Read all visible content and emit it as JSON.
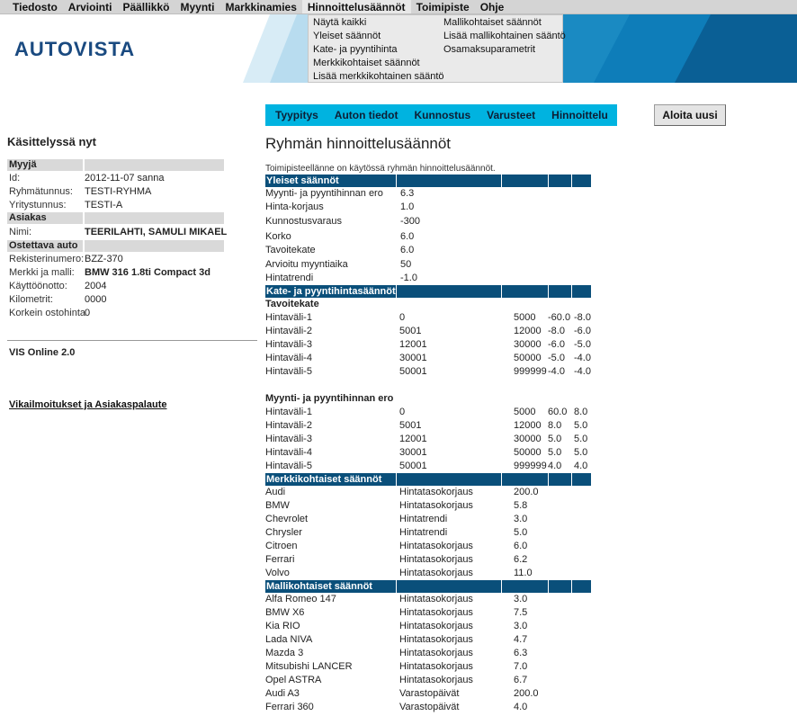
{
  "menu": [
    "Tiedosto",
    "Arviointi",
    "Päällikkö",
    "Myynti",
    "Markkinamies",
    "Hinnoittelusäännöt",
    "Toimipiste",
    "Ohje"
  ],
  "dropdown": {
    "col1": [
      "Näytä kaikki",
      "Yleiset säännöt",
      "Kate- ja pyyntihinta",
      "Merkkikohtaiset säännöt",
      "Lisää merkkikohtainen sääntö"
    ],
    "col2": [
      "Mallikohtaiset säännöt",
      "Lisää mallikohtainen sääntö",
      "Osamaksuparametrit"
    ]
  },
  "logo": "AUTOVISTA",
  "tabs": [
    "Tyypitys",
    "Auton tiedot",
    "Kunnostus",
    "Varusteet",
    "Hinnoittelu"
  ],
  "restart_label": "Aloita uusi",
  "left": {
    "title": "Käsittelyssä nyt",
    "sections": [
      {
        "heading": "Myyjä",
        "rows": [
          {
            "k": "Id:",
            "v": "2012-11-07  sanna",
            "bold": false
          },
          {
            "k": "Ryhmätunnus:",
            "v": "TESTI-RYHMA",
            "bold": false
          },
          {
            "k": "Yritystunnus:",
            "v": "TESTI-A",
            "bold": false
          }
        ]
      },
      {
        "heading": "Asiakas",
        "rows": [
          {
            "k": "Nimi:",
            "v": "TEERILAHTI, SAMULI MIKAEL",
            "bold": true
          }
        ]
      },
      {
        "heading": "Ostettava auto",
        "rows": [
          {
            "k": "Rekisterinumero:",
            "v": "BZZ-370",
            "bold": false
          },
          {
            "k": "Merkki ja malli:",
            "v": "BMW 316 1.8ti Compact 3d",
            "bold": true
          },
          {
            "k": "Käyttöönotto:",
            "v": "2004",
            "bold": false
          },
          {
            "k": "Kilometrit:",
            "v": "0000",
            "bold": false
          },
          {
            "k": "Korkein ostohinta",
            "v": "0",
            "bold": false
          }
        ]
      }
    ],
    "vis": "VIS Online 2.0",
    "feedback": "Vikailmoitukset ja Asiakaspalaute"
  },
  "main": {
    "title": "Ryhmän hinnoittelusäännöt",
    "intro": "Toimipisteellänne on käytössä ryhmän hinnoittelusäännöt.",
    "general": {
      "heading": "Yleiset säännöt",
      "rows": [
        {
          "label": "Myynti- ja pyyntihinnan ero",
          "value": "6.3"
        },
        {
          "label": "Hinta-korjaus",
          "value": "1.0"
        },
        {
          "label": "Kunnostusvaraus",
          "value": "-300"
        },
        {
          "label": "Korko",
          "value": "6.0"
        },
        {
          "label": "Tavoitekate",
          "value": "6.0"
        },
        {
          "label": "Arvioitu myyntiaika",
          "value": "50"
        },
        {
          "label": "Hintatrendi",
          "value": "-1.0"
        }
      ]
    },
    "margin": {
      "heading": "Kate- ja pyyntihintasäännöt",
      "groups": [
        {
          "title": "Tavoitekate",
          "rows": [
            [
              "Hintaväli-1",
              "0",
              "5000",
              "-60.0",
              "-8.0"
            ],
            [
              "Hintaväli-2",
              "5001",
              "12000",
              "-8.0",
              "-6.0"
            ],
            [
              "Hintaväli-3",
              "12001",
              "30000",
              "-6.0",
              "-5.0"
            ],
            [
              "Hintaväli-4",
              "30001",
              "50000",
              "-5.0",
              "-4.0"
            ],
            [
              "Hintaväli-5",
              "50001",
              "999999",
              "-4.0",
              "-4.0"
            ]
          ]
        },
        {
          "title": "Myynti- ja pyyntihinnan ero",
          "rows": [
            [
              "Hintaväli-1",
              "0",
              "5000",
              "60.0",
              "8.0"
            ],
            [
              "Hintaväli-2",
              "5001",
              "12000",
              "8.0",
              "5.0"
            ],
            [
              "Hintaväli-3",
              "12001",
              "30000",
              "5.0",
              "5.0"
            ],
            [
              "Hintaväli-4",
              "30001",
              "50000",
              "5.0",
              "5.0"
            ],
            [
              "Hintaväli-5",
              "50001",
              "999999",
              "4.0",
              "4.0"
            ]
          ]
        }
      ]
    },
    "brand": {
      "heading": "Merkkikohtaiset säännöt",
      "rows": [
        [
          "Audi",
          "Hintatasokorjaus",
          "200.0"
        ],
        [
          "BMW",
          "Hintatasokorjaus",
          "5.8"
        ],
        [
          "Chevrolet",
          "Hintatrendi",
          "3.0"
        ],
        [
          "Chrysler",
          "Hintatrendi",
          "5.0"
        ],
        [
          "Citroen",
          "Hintatasokorjaus",
          "6.0"
        ],
        [
          "Ferrari",
          "Hintatasokorjaus",
          "6.2"
        ],
        [
          "Volvo",
          "Hintatasokorjaus",
          "11.0"
        ]
      ]
    },
    "model": {
      "heading": "Mallikohtaiset säännöt",
      "rows": [
        [
          "Alfa Romeo 147",
          "Hintatasokorjaus",
          "3.0"
        ],
        [
          "BMW X6",
          "Hintatasokorjaus",
          "7.5"
        ],
        [
          "Kia RIO",
          "Hintatasokorjaus",
          "3.0"
        ],
        [
          "Lada NIVA",
          "Hintatasokorjaus",
          "4.7"
        ],
        [
          "Mazda 3",
          "Hintatasokorjaus",
          "6.3"
        ],
        [
          "Mitsubishi LANCER",
          "Hintatasokorjaus",
          "7.0"
        ],
        [
          "Opel ASTRA",
          "Hintatasokorjaus",
          "6.7"
        ],
        [
          "Audi A3",
          "Varastopäivät",
          "200.0"
        ],
        [
          "Ferrari 360",
          "Varastopäivät",
          "4.0"
        ]
      ]
    }
  },
  "colors": {
    "menubar": "#d4d4d4",
    "tabs": "#00b3e0",
    "section_bar": "#0a4f7a",
    "logo": "#1a4a80"
  }
}
